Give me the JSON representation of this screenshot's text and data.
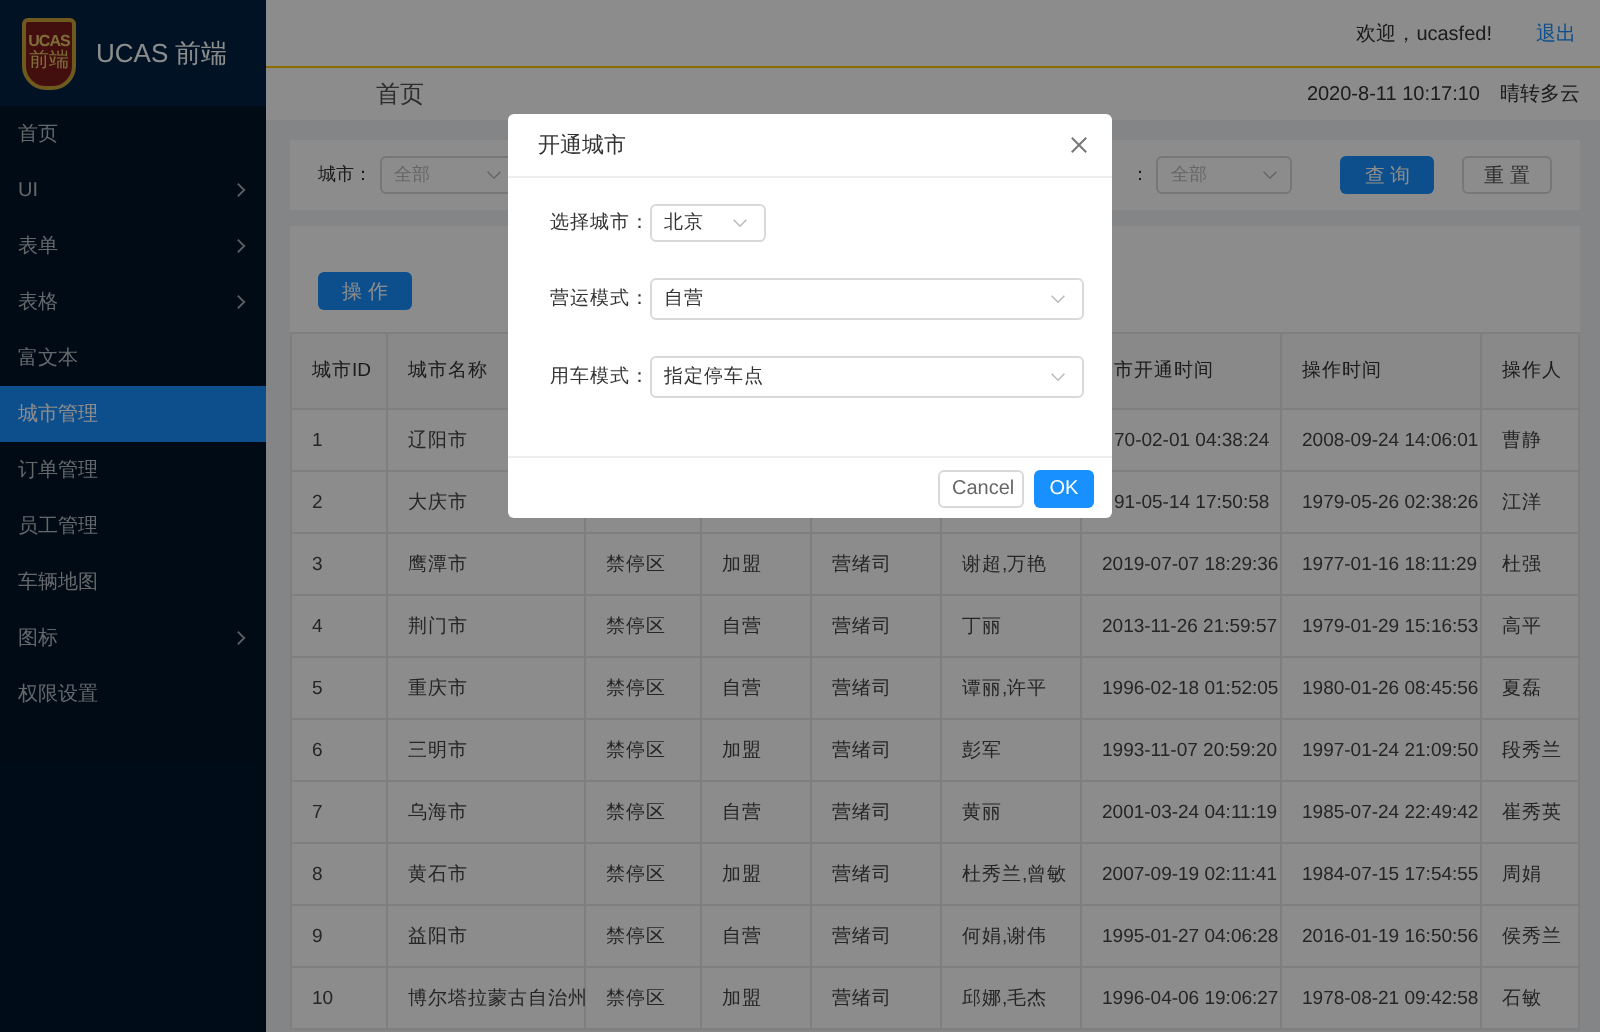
{
  "sidebar": {
    "logo_badge_top": "UCAS",
    "logo_badge_bottom": "前端",
    "brand": "UCAS 前端",
    "items": [
      {
        "label": "首页",
        "has_submenu": false,
        "selected": false
      },
      {
        "label": "UI",
        "has_submenu": true,
        "selected": false
      },
      {
        "label": "表单",
        "has_submenu": true,
        "selected": false
      },
      {
        "label": "表格",
        "has_submenu": true,
        "selected": false
      },
      {
        "label": "富文本",
        "has_submenu": false,
        "selected": false
      },
      {
        "label": "城市管理",
        "has_submenu": false,
        "selected": true
      },
      {
        "label": "订单管理",
        "has_submenu": false,
        "selected": false
      },
      {
        "label": "员工管理",
        "has_submenu": false,
        "selected": false
      },
      {
        "label": "车辆地图",
        "has_submenu": false,
        "selected": false
      },
      {
        "label": "图标",
        "has_submenu": true,
        "selected": false
      },
      {
        "label": "权限设置",
        "has_submenu": false,
        "selected": false
      }
    ]
  },
  "header": {
    "welcome": "欢迎，ucasfed!",
    "logout": "退出",
    "breadcrumb": "首页",
    "datetime": "2020-8-11 10:17:10",
    "weather": "晴转多云"
  },
  "filters": {
    "city_label": "城市：",
    "city_value": "全部",
    "column_label": "：",
    "column_value": "全部",
    "query_button": "查 询",
    "reset_button": "重 置"
  },
  "action_button": "操 作",
  "table": {
    "header": {
      "id": "城市ID",
      "name": "城市名称",
      "open_time": "市开通时间",
      "op_time": "操作时间",
      "operator": "操作人"
    },
    "rows": [
      {
        "id": "1",
        "name": "辽阳市",
        "open_time": "70-02-01 04:38:24",
        "op_time": "2008-09-24 14:06:01",
        "operator": "曹静"
      },
      {
        "id": "2",
        "name": "大庆市",
        "open_time": "91-05-14 17:50:58",
        "op_time": "1979-05-26 02:38:26",
        "operator": "江洋"
      },
      {
        "id": "3",
        "name": "鹰潭市",
        "column_3": "禁停区",
        "column_4": "加盟",
        "column_5": "营绪司",
        "column_6": "谢超,万艳",
        "open_time": "2019-07-07 18:29:36",
        "op_time": "1977-01-16 18:11:29",
        "operator": "杜强"
      },
      {
        "id": "4",
        "name": "荆门市",
        "column_3": "禁停区",
        "column_4": "自营",
        "column_5": "营绪司",
        "column_6": "丁丽",
        "open_time": "2013-11-26 21:59:57",
        "op_time": "1979-01-29 15:16:53",
        "operator": "高平"
      },
      {
        "id": "5",
        "name": "重庆市",
        "column_3": "禁停区",
        "column_4": "自营",
        "column_5": "营绪司",
        "column_6": "谭丽,许平",
        "open_time": "1996-02-18 01:52:05",
        "op_time": "1980-01-26 08:45:56",
        "operator": "夏磊"
      },
      {
        "id": "6",
        "name": "三明市",
        "column_3": "禁停区",
        "column_4": "加盟",
        "column_5": "营绪司",
        "column_6": "彭军",
        "open_time": "1993-11-07 20:59:20",
        "op_time": "1997-01-24 21:09:50",
        "operator": "段秀兰"
      },
      {
        "id": "7",
        "name": "乌海市",
        "column_3": "禁停区",
        "column_4": "自营",
        "column_5": "营绪司",
        "column_6": "黄丽",
        "open_time": "2001-03-24 04:11:19",
        "op_time": "1985-07-24 22:49:42",
        "operator": "崔秀英"
      },
      {
        "id": "8",
        "name": "黄石市",
        "column_3": "禁停区",
        "column_4": "加盟",
        "column_5": "营绪司",
        "column_6": "杜秀兰,曾敏",
        "open_time": "2007-09-19 02:11:41",
        "op_time": "1984-07-15 17:54:55",
        "operator": "周娟"
      },
      {
        "id": "9",
        "name": "益阳市",
        "column_3": "禁停区",
        "column_4": "自营",
        "column_5": "营绪司",
        "column_6": "何娟,谢伟",
        "open_time": "1995-01-27 04:06:28",
        "op_time": "2016-01-19 16:50:56",
        "operator": "侯秀兰"
      },
      {
        "id": "10",
        "name": "博尔塔拉蒙古自治州",
        "column_3": "禁停区",
        "column_4": "加盟",
        "column_5": "营绪司",
        "column_6": "邱娜,毛杰",
        "open_time": "1996-04-06 19:06:27",
        "op_time": "1978-08-21 09:42:58",
        "operator": "石敏"
      }
    ]
  },
  "modal": {
    "title": "开通城市",
    "fields": [
      {
        "label": "选择城市：",
        "value": "北京",
        "kind": "select"
      },
      {
        "label": "营运模式：",
        "value": "自营",
        "kind": "select"
      },
      {
        "label": "用车模式：",
        "value": "指定停车点",
        "kind": "select"
      }
    ],
    "cancel": "Cancel",
    "ok": "OK"
  }
}
